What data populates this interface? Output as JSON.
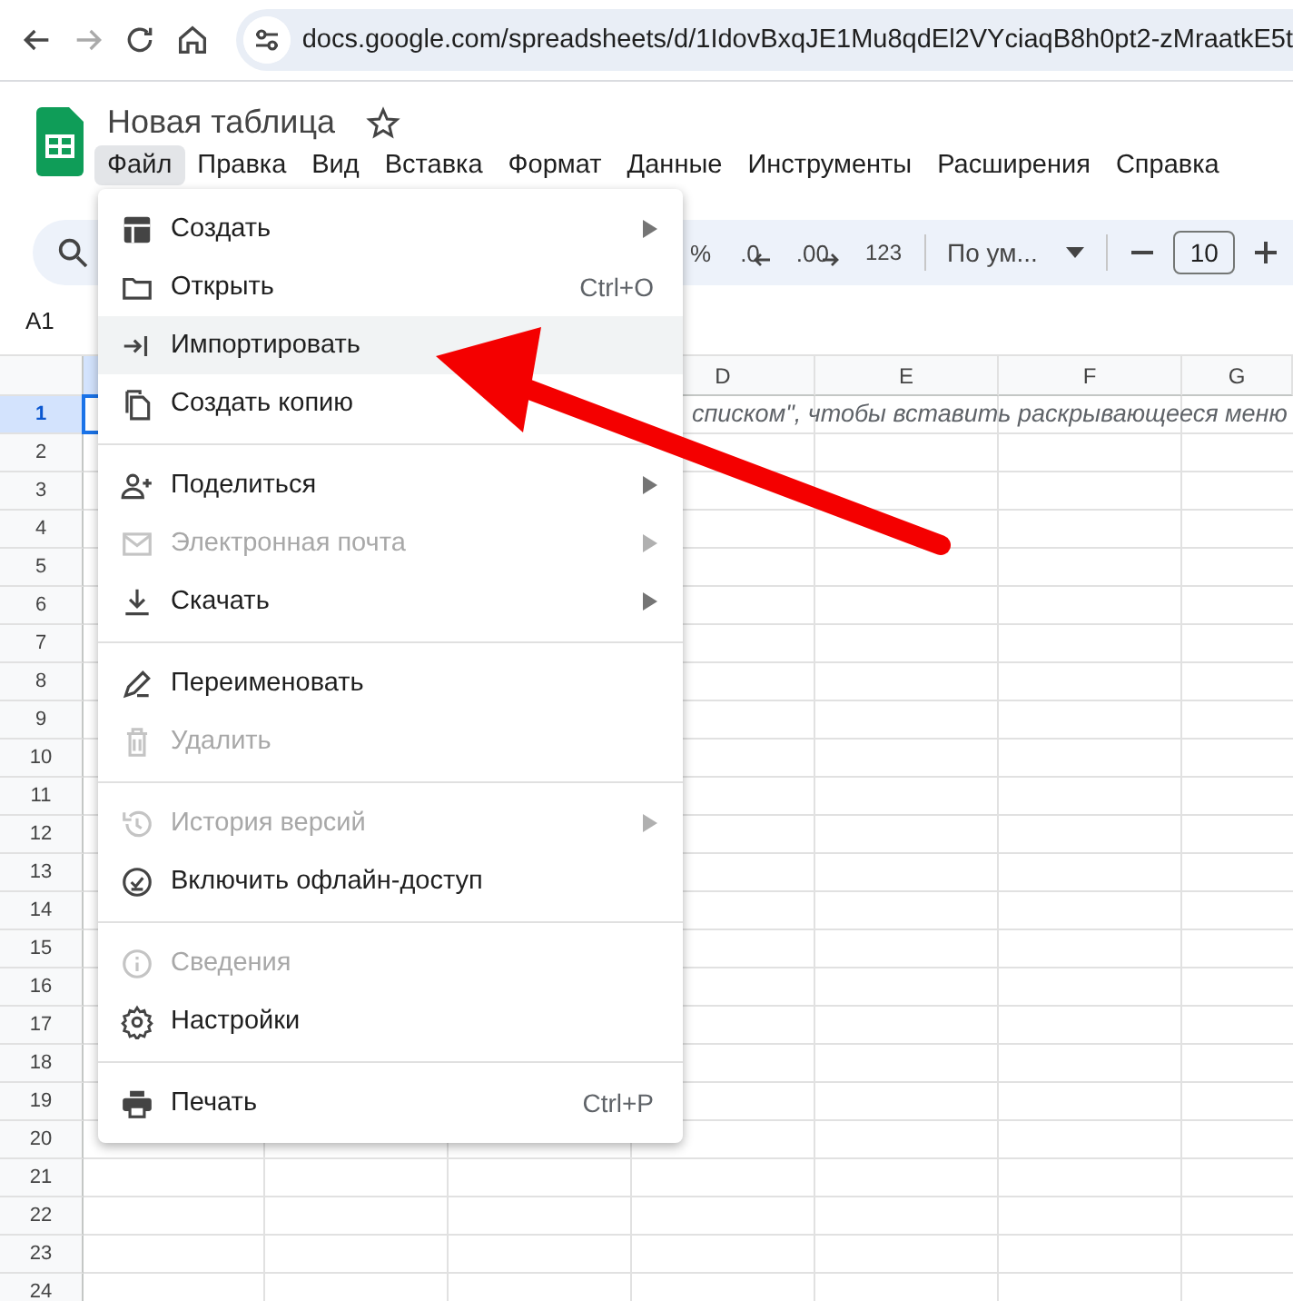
{
  "browser": {
    "back_disabled": false,
    "forward_disabled": true,
    "url": "docs.google.com/spreadsheets/d/1IdovBxqJE1Mu8qdEl2VYciaqB8h0pt2-zMraatkE5t"
  },
  "document": {
    "title": "Новая таблица",
    "starred": false
  },
  "menubar": [
    {
      "label": "Файл",
      "selected": true
    },
    {
      "label": "Правка",
      "selected": false
    },
    {
      "label": "Вид",
      "selected": false
    },
    {
      "label": "Вставка",
      "selected": false
    },
    {
      "label": "Формат",
      "selected": false
    },
    {
      "label": "Данные",
      "selected": false
    },
    {
      "label": "Инструменты",
      "selected": false
    },
    {
      "label": "Расширения",
      "selected": false
    },
    {
      "label": "Справка",
      "selected": false
    }
  ],
  "toolbar": {
    "percent": "%",
    "decrease_decimal": ".0",
    "increase_decimal": ".00",
    "number_format": "123",
    "font": "По ум...",
    "font_size": "10"
  },
  "name_box": "A1",
  "sheet": {
    "covered_column": {
      "selected": true
    },
    "columns": [
      {
        "label": "D",
        "selected": false
      },
      {
        "label": "E",
        "selected": false
      },
      {
        "label": "F",
        "selected": false
      },
      {
        "label": "G",
        "selected": false
      }
    ],
    "rows": [
      {
        "label": "1",
        "selected": true
      },
      {
        "label": "2",
        "selected": false
      },
      {
        "label": "3",
        "selected": false
      },
      {
        "label": "4",
        "selected": false
      },
      {
        "label": "5",
        "selected": false
      },
      {
        "label": "6",
        "selected": false
      },
      {
        "label": "7",
        "selected": false
      },
      {
        "label": "8",
        "selected": false
      },
      {
        "label": "9",
        "selected": false
      },
      {
        "label": "10",
        "selected": false
      },
      {
        "label": "11",
        "selected": false
      },
      {
        "label": "12",
        "selected": false
      },
      {
        "label": "13",
        "selected": false
      },
      {
        "label": "14",
        "selected": false
      },
      {
        "label": "15",
        "selected": false
      },
      {
        "label": "16",
        "selected": false
      },
      {
        "label": "17",
        "selected": false
      },
      {
        "label": "18",
        "selected": false
      },
      {
        "label": "19",
        "selected": false
      },
      {
        "label": "20",
        "selected": false
      },
      {
        "label": "21",
        "selected": false
      },
      {
        "label": "22",
        "selected": false
      },
      {
        "label": "23",
        "selected": false
      },
      {
        "label": "24",
        "selected": false
      }
    ],
    "row1_text": "списком\", чтобы вставить раскрывающееся меню"
  },
  "file_menu": {
    "groups": [
      {
        "items": [
          {
            "label": "Создать",
            "submenu": true,
            "disabled": false,
            "selected": false
          },
          {
            "label": "Открыть",
            "shortcut": "Ctrl+O",
            "submenu": false,
            "disabled": false,
            "selected": false
          },
          {
            "label": "Импортировать",
            "submenu": false,
            "disabled": false,
            "selected": true
          },
          {
            "label": "Создать копию",
            "submenu": false,
            "disabled": false,
            "selected": false
          }
        ]
      },
      {
        "items": [
          {
            "label": "Поделиться",
            "submenu": true,
            "disabled": false,
            "selected": false
          },
          {
            "label": "Электронная почта",
            "submenu": true,
            "disabled": true,
            "selected": false
          },
          {
            "label": "Скачать",
            "submenu": true,
            "disabled": false,
            "selected": false
          }
        ]
      },
      {
        "items": [
          {
            "label": "Переименовать",
            "submenu": false,
            "disabled": false,
            "selected": false
          },
          {
            "label": "Удалить",
            "submenu": false,
            "disabled": true,
            "selected": false
          }
        ]
      },
      {
        "items": [
          {
            "label": "История версий",
            "submenu": true,
            "disabled": true,
            "selected": false
          },
          {
            "label": "Включить офлайн-доступ",
            "submenu": false,
            "disabled": false,
            "selected": false
          }
        ]
      },
      {
        "items": [
          {
            "label": "Сведения",
            "submenu": false,
            "disabled": true,
            "selected": false
          },
          {
            "label": "Настройки",
            "submenu": false,
            "disabled": false,
            "selected": false
          }
        ]
      },
      {
        "items": [
          {
            "label": "Печать",
            "shortcut": "Ctrl+P",
            "submenu": false,
            "disabled": false,
            "selected": false
          }
        ]
      }
    ]
  }
}
